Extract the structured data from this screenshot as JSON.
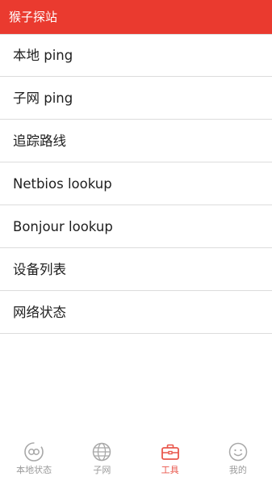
{
  "header": {
    "title": "猴子探站"
  },
  "menu": {
    "items": [
      {
        "label": "本地 ping"
      },
      {
        "label": "子网 ping"
      },
      {
        "label": "追踪路线"
      },
      {
        "label": "Netbios lookup"
      },
      {
        "label": "Bonjour lookup"
      },
      {
        "label": "设备列表"
      },
      {
        "label": "网络状态"
      }
    ]
  },
  "tabbar": {
    "tabs": [
      {
        "label": "本地状态",
        "icon": "local-status-icon",
        "active": false
      },
      {
        "label": "子网",
        "icon": "globe-icon",
        "active": false
      },
      {
        "label": "工具",
        "icon": "toolbox-icon",
        "active": true
      },
      {
        "label": "我的",
        "icon": "smiley-icon",
        "active": false
      }
    ]
  },
  "colors": {
    "header_bg": "#ea3a2f",
    "active_tab": "#e9574c",
    "inactive_tab": "#9a9a9a",
    "divider": "#dcdcdc"
  }
}
